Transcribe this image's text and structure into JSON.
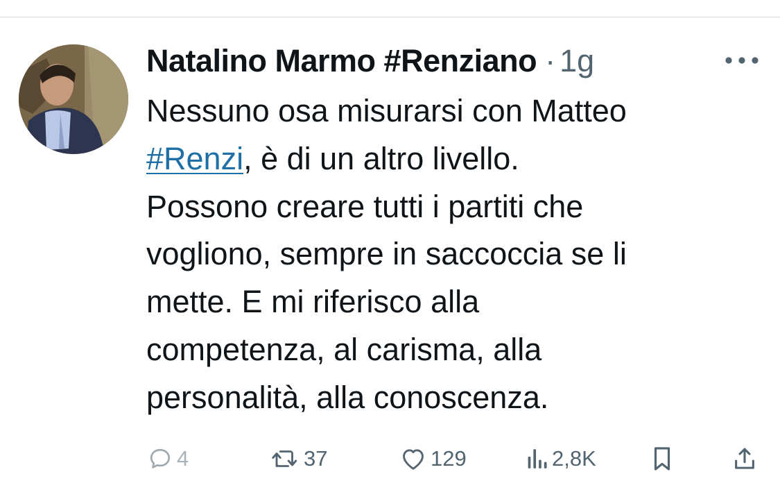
{
  "tweet": {
    "author": {
      "name": "Natalino Marmo #Renziano",
      "avatar_icon": "profile-photo"
    },
    "separator": "·",
    "time": "1g",
    "more_icon": "more-horizontal-icon",
    "text": {
      "line1": "Nessuno osa misurarsi con Matteo",
      "line2_hashtag": "#Renzi",
      "line2_rest": ", è di un altro livello.",
      "line3": "Possono creare tutti i partiti che",
      "line4": "vogliono, sempre in saccoccia se li",
      "line5": "mette. E mi riferisco alla",
      "line6": "competenza, al carisma, alla",
      "line7": "personalità, alla conoscenza."
    },
    "actions": {
      "reply": {
        "icon": "reply-icon",
        "count": "4"
      },
      "retweet": {
        "icon": "retweet-icon",
        "count": "37"
      },
      "like": {
        "icon": "heart-icon",
        "count": "129"
      },
      "views": {
        "icon": "views-chart-icon",
        "count": "2,8K"
      },
      "bookmark": {
        "icon": "bookmark-icon"
      },
      "share": {
        "icon": "share-icon"
      }
    },
    "colors": {
      "text": "#0f1419",
      "muted": "#536471",
      "hashtag": "#1d6fa5"
    }
  }
}
